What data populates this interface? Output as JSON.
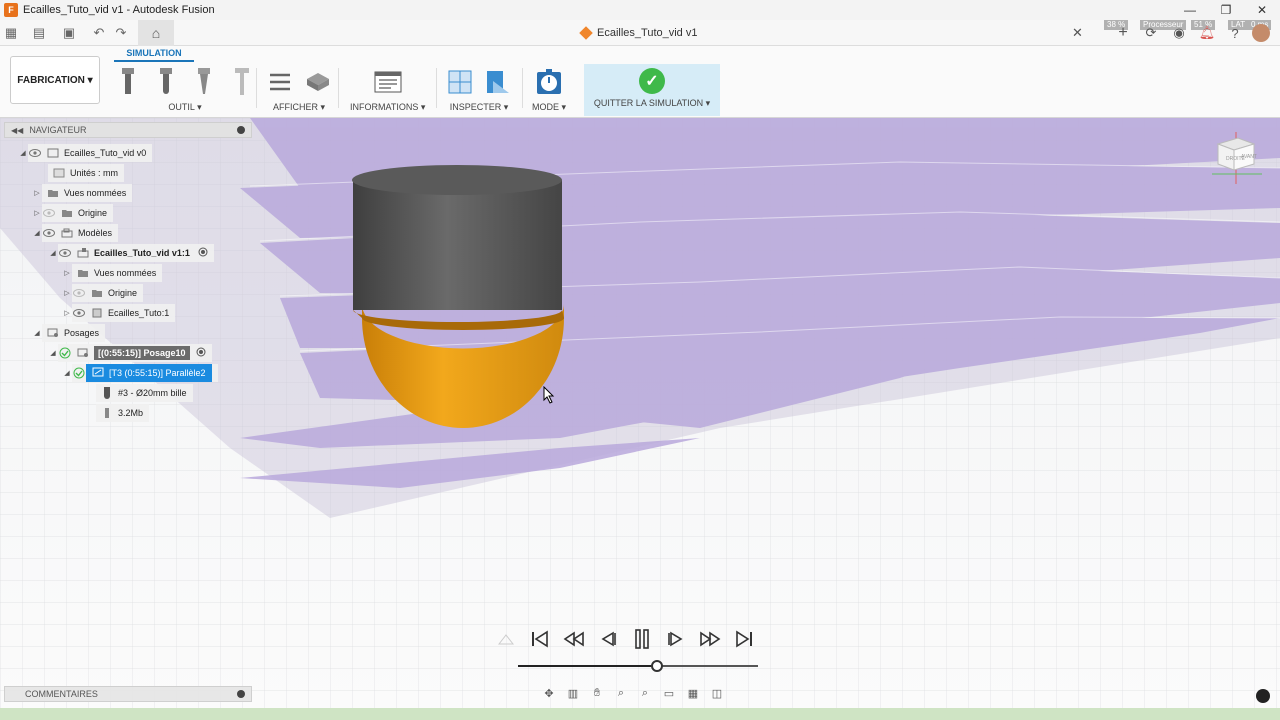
{
  "window": {
    "title": "Ecailles_Tuto_vid v1 - Autodesk Fusion",
    "logo_letter": "F",
    "controls": [
      "—",
      "❐",
      "✕"
    ]
  },
  "document_tab": {
    "title": "Ecailles_Tuto_vid v1",
    "close": "✕"
  },
  "performance": {
    "cpu_percent": "38 %",
    "processor_label": "Processeur",
    "processor_percent": "51 %",
    "lat_label": "LAT",
    "lat_value": "0 ms"
  },
  "toolbar": {
    "workspace_tab": "SIMULATION",
    "workspace_button": "FABRICATION ▾",
    "groups": {
      "outil": "OUTIL ▾",
      "afficher": "AFFICHER ▾",
      "informations": "INFORMATIONS ▾",
      "inspecter": "INSPECTER ▾",
      "mode": "MODE ▾",
      "quitter": "QUITTER LA SIMULATION ▾"
    }
  },
  "navigator": {
    "title": "NAVIGATEUR",
    "items": [
      {
        "label": "Ecailles_Tuto_vid v0"
      },
      {
        "label": "Unités : mm"
      },
      {
        "label": "Vues nommées"
      },
      {
        "label": "Origine"
      },
      {
        "label": "Modèles"
      },
      {
        "label": "Ecailles_Tuto_vid v1:1"
      },
      {
        "label": "Vues nommées"
      },
      {
        "label": "Origine"
      },
      {
        "label": "Ecailles_Tuto:1"
      },
      {
        "label": "Posages"
      },
      {
        "label": "[(0:55:15)] Posage10"
      },
      {
        "label": "[T3 (0:55:15)] Parallèle2"
      },
      {
        "label": "#3 - Ø20mm bille"
      },
      {
        "label": "3.2Mb"
      }
    ]
  },
  "comments": {
    "title": "COMMENTAIRES"
  },
  "playback": {
    "progress": 0.58
  },
  "colors": {
    "accent": "#1a8be0",
    "tool_body": "#4f4f4f",
    "tool_tip": "#e39a12",
    "stock": "#b7a6d8",
    "quit_check": "#3fb94a"
  }
}
